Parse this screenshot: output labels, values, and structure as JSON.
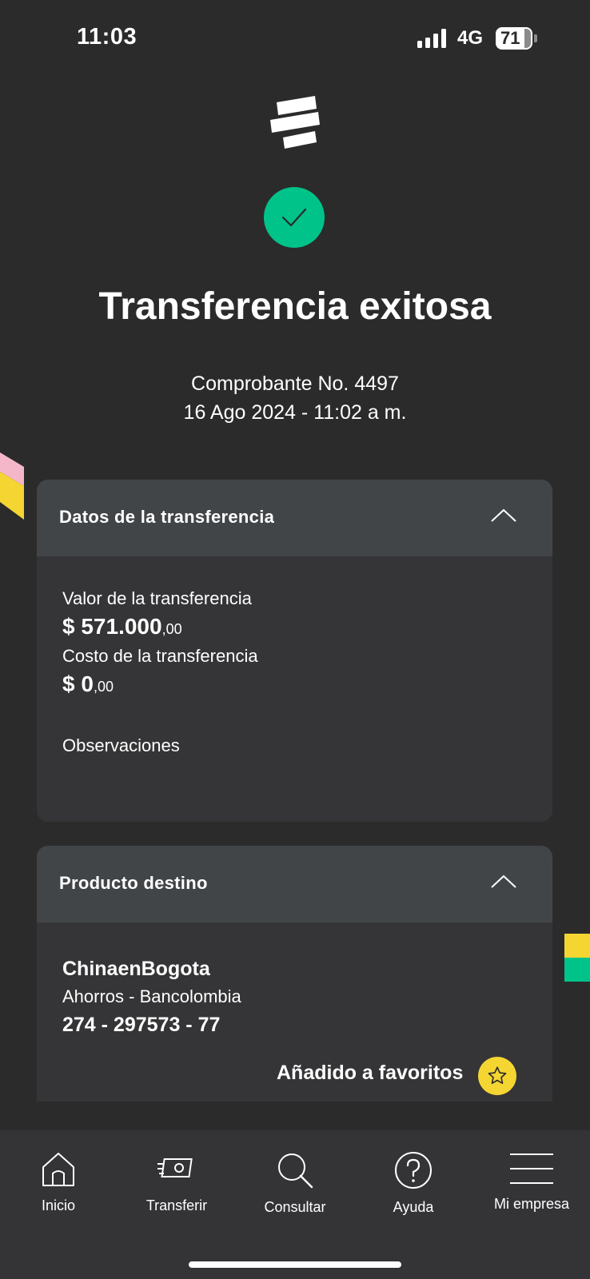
{
  "status_bar": {
    "time": "11:03",
    "network": "4G",
    "battery": "71"
  },
  "result": {
    "title": "Transferencia exitosa",
    "receipt": "Comprobante No. 4497",
    "datetime": "16 Ago 2024 - 11:02 a m."
  },
  "transfer_card": {
    "header": "Datos de la transferencia",
    "value_label": "Valor de la transferencia",
    "value_main": "$ 571.000",
    "value_cents": ",00",
    "cost_label": "Costo de la transferencia",
    "cost_main": "$ 0",
    "cost_cents": ",00",
    "notes_label": "Observaciones"
  },
  "destination_card": {
    "header": "Producto destino",
    "name": "ChinaenBogota",
    "account_type": "Ahorros - Bancolombia",
    "account_number": "274 - 297573 - 77",
    "favorite_label": "Añadido a favoritos"
  },
  "bottom_nav": {
    "items": [
      {
        "label": "Inicio",
        "icon": "home-icon"
      },
      {
        "label": "Transferir",
        "icon": "transfer-icon"
      },
      {
        "label": "Consultar",
        "icon": "search-icon"
      },
      {
        "label": "Ayuda",
        "icon": "help-icon"
      },
      {
        "label": "Mi empresa",
        "icon": "menu-icon"
      }
    ]
  },
  "colors": {
    "background": "#2b2b2b",
    "card": "#353537",
    "card_header": "#424548",
    "success": "#00c389",
    "favorite": "#f5d532"
  }
}
